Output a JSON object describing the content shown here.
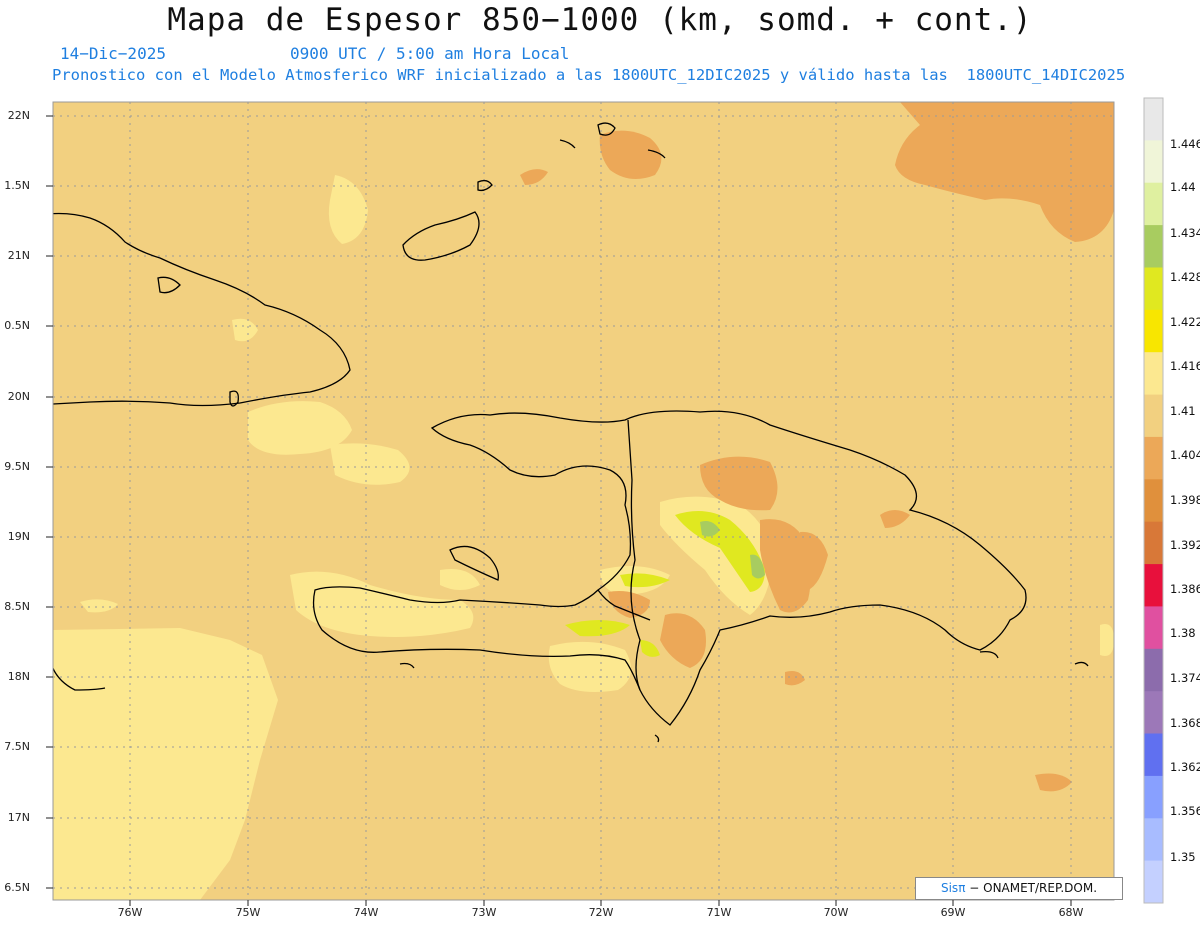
{
  "header": {
    "title": "Mapa de Espesor 850−1000 (km, somd. + cont.)",
    "date": "14−Dic−2025",
    "time": "0900 UTC / 5:00 am Hora Local",
    "description": "Pronostico con el Modelo Atmosferico WRF inicializado a las 1800UTC_12DIC2025 y válido hasta las  1800UTC_14DIC2025"
  },
  "axes": {
    "lat_labels": [
      "22N",
      "1.5N",
      "21N",
      "0.5N",
      "20N",
      "9.5N",
      "19N",
      "8.5N",
      "18N",
      "7.5N",
      "17N",
      "6.5N"
    ],
    "lon_labels": [
      "76W",
      "75W",
      "74W",
      "73W",
      "72W",
      "71W",
      "70W",
      "69W",
      "68W"
    ]
  },
  "colorbar": {
    "labels": [
      "1.446",
      "1.44",
      "1.434",
      "1.428",
      "1.422",
      "1.416",
      "1.41",
      "1.404",
      "1.398",
      "1.392",
      "1.386",
      "1.38",
      "1.374",
      "1.368",
      "1.362",
      "1.356",
      "1.35"
    ],
    "colors": [
      "#e8e8e8",
      "#f0f5d8",
      "#dff0a0",
      "#a8cc60",
      "#e0e820",
      "#f8e600",
      "#fce890",
      "#f2d080",
      "#eca858",
      "#e0903c",
      "#d87838",
      "#e8103c",
      "#e050a0",
      "#8c6cac",
      "#9c78b8",
      "#6070f0",
      "#88a0ff",
      "#a8bcff",
      "#c4d0ff"
    ]
  },
  "credit": {
    "brand": "Sisπ",
    "text": "− ONAMET/REP.DOM."
  }
}
